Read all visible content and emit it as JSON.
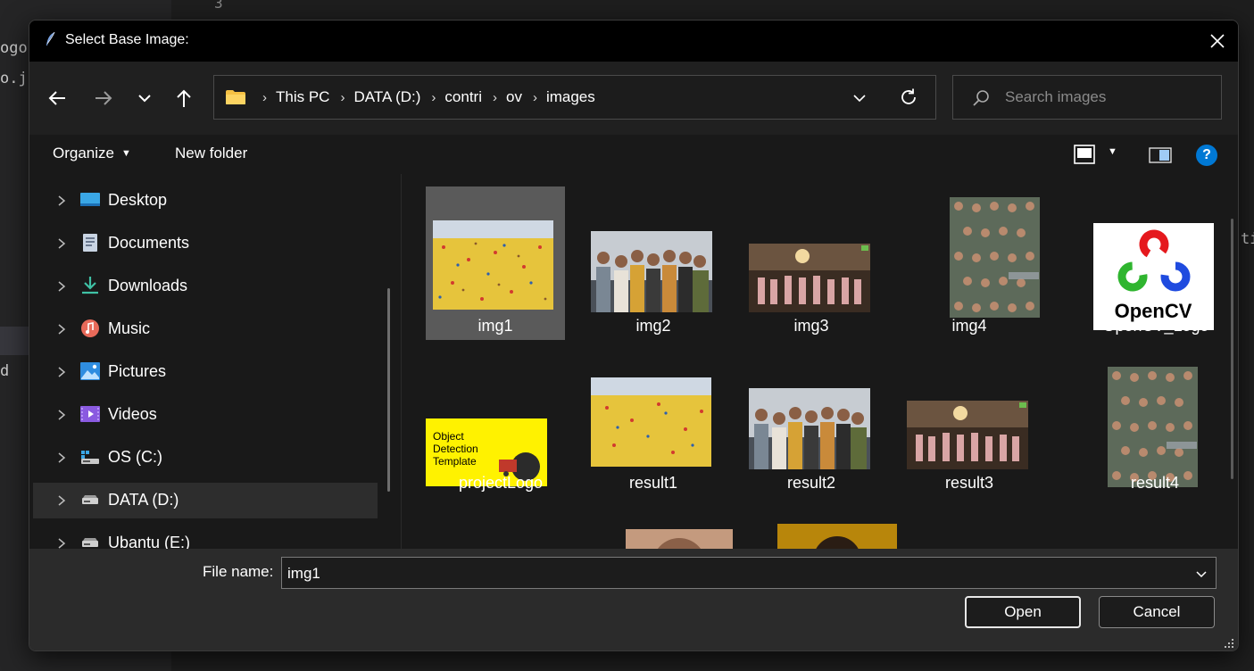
{
  "background": {
    "left_fragments": [
      "ogo",
      "o.jp",
      "d"
    ],
    "right_fragment": "ti",
    "top_fragment": "3"
  },
  "dialog": {
    "title": "Select Base Image:",
    "icons": {
      "app": "feather-icon",
      "close": "close-icon"
    }
  },
  "nav": {
    "back_icon": "arrow-left-icon",
    "forward_icon": "arrow-right-icon",
    "recent_icon": "chevron-down-icon",
    "up_icon": "arrow-up-icon",
    "breadcrumbs": [
      "This PC",
      "DATA (D:)",
      "contri",
      "ov",
      "images"
    ],
    "search_placeholder": "Search images"
  },
  "toolbar": {
    "organize": "Organize",
    "new_folder": "New folder"
  },
  "sidebar": {
    "items": [
      {
        "label": "Desktop",
        "icon": "desktop-icon"
      },
      {
        "label": "Documents",
        "icon": "documents-icon"
      },
      {
        "label": "Downloads",
        "icon": "downloads-icon"
      },
      {
        "label": "Music",
        "icon": "music-icon"
      },
      {
        "label": "Pictures",
        "icon": "pictures-icon"
      },
      {
        "label": "Videos",
        "icon": "videos-icon"
      },
      {
        "label": "OS (C:)",
        "icon": "drive-c-icon"
      },
      {
        "label": "DATA (D:)",
        "icon": "drive-icon"
      },
      {
        "label": "Ubantu (E:)",
        "icon": "drive-icon"
      }
    ],
    "selected": "DATA (D:)"
  },
  "files": [
    {
      "name": "img1",
      "selected": true
    },
    {
      "name": "img2"
    },
    {
      "name": "img3"
    },
    {
      "name": "img4"
    },
    {
      "name": "OpenCV_Logo"
    },
    {
      "name": "projectLogo"
    },
    {
      "name": "result1"
    },
    {
      "name": "result2"
    },
    {
      "name": "result3"
    },
    {
      "name": "result4"
    }
  ],
  "opencv_logo_text": "OpenCV",
  "project_logo_text": [
    "Object",
    "Detection",
    "Template"
  ],
  "footer": {
    "file_name_label": "File name:",
    "file_name_value": "img1",
    "open_label": "Open",
    "cancel_label": "Cancel"
  },
  "colors": {
    "accent": "#0078d4",
    "selection": "#5a5a5a",
    "folder": "#f5c144"
  }
}
